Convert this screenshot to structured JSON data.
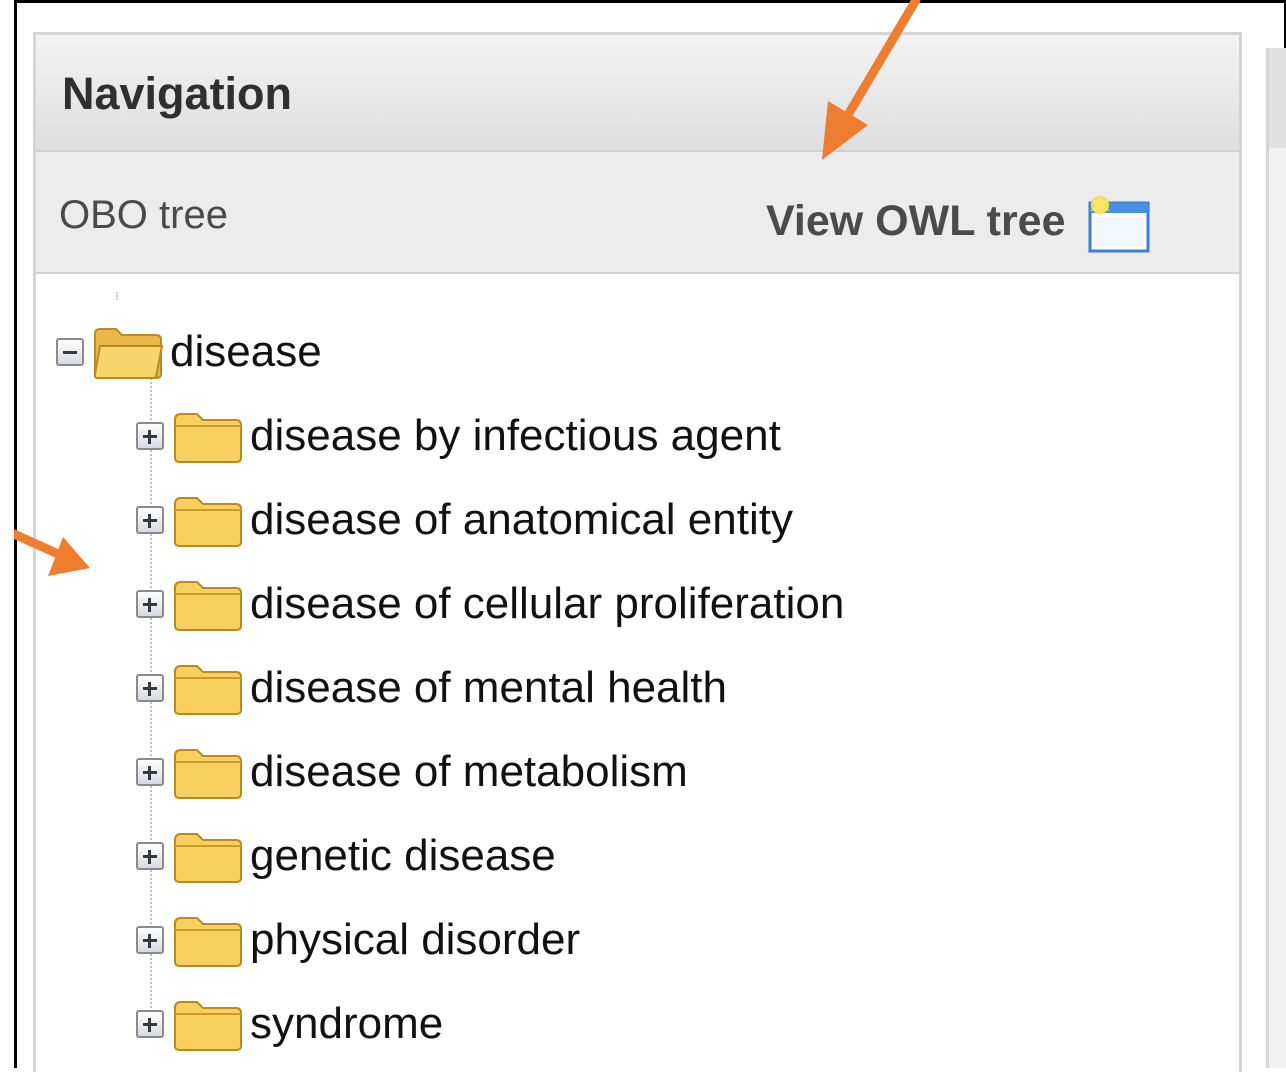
{
  "navigation": {
    "title": "Navigation",
    "tree_label": "OBO tree",
    "owl_link": "View OWL tree",
    "owl_icon": "new-window-icon"
  },
  "tree": {
    "root": {
      "label": "disease",
      "expanded": true,
      "children": [
        {
          "label": "disease by infectious agent"
        },
        {
          "label": "disease of anatomical entity"
        },
        {
          "label": "disease of cellular proliferation"
        },
        {
          "label": "disease of mental health"
        },
        {
          "label": "disease of metabolism"
        },
        {
          "label": "genetic disease"
        },
        {
          "label": "physical disorder"
        },
        {
          "label": "syndrome"
        }
      ]
    }
  },
  "colors": {
    "annotation_arrow": "#ee7d30",
    "folder_fill": "#f6cf5c",
    "header_text": "#2f2f2f"
  }
}
